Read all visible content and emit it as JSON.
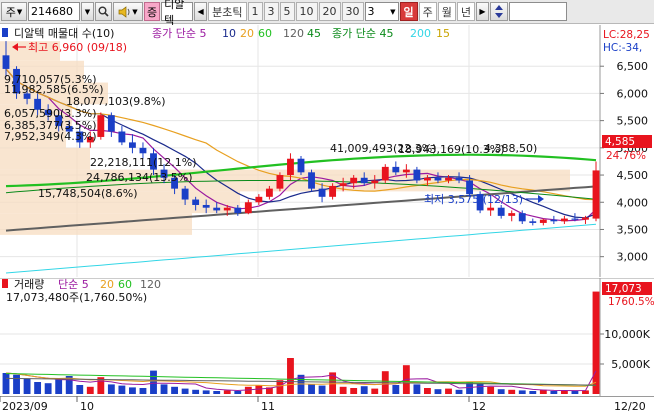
{
  "toolbar": {
    "mode_label": "주",
    "code": "214680",
    "search_icon": "magnifier-icon",
    "speaker_icon": "speaker-icon",
    "badge": "증",
    "stock_name": "디알텍",
    "period_prev_icon": "triangle-left-icon",
    "period_label": "분초틱",
    "intervals": [
      "1",
      "3",
      "5",
      "10",
      "20",
      "30"
    ],
    "interval_value": "3",
    "day_label": "일",
    "week_label": "주",
    "month_label": "월",
    "year_label": "년",
    "period_next_icon": "triangle-right-icon",
    "updown_icon": "up-down-arrows-icon"
  },
  "colors": {
    "up": "#e8141e",
    "down": "#1a3fc7",
    "ma5": "#9b1aa0",
    "ma10": "#1a2a8c",
    "ma20": "#e8a020",
    "ma60": "#22c022",
    "ma120": "#606060",
    "vma45": "#0b8a1a",
    "vma200": "#33d6e6",
    "vma15": "#c8a400",
    "box": "#f7dcc0"
  },
  "price_legend": {
    "title": "디알텍 매물대 수(10)",
    "ma_label": "종가 단순 5",
    "periods": [
      "10",
      "20",
      "60",
      "120",
      "45"
    ],
    "ma2_label": "종가 단순 45",
    "periods2": [
      "200",
      "15"
    ]
  },
  "price_axis": {
    "ticks": [
      "6,500",
      "6,000",
      "5,500",
      "5,000",
      "4,500",
      "4,000",
      "3,500",
      "3,000"
    ],
    "lc_label": "LC:28,25",
    "hc_label": "HC:-34,",
    "current_price": "4,585",
    "current_change": "24.76%"
  },
  "volume_profile": [
    "9,710,057(5.3%)",
    "11,982,585(6.5%)",
    "18,077,103(9.8%)",
    "6,057,590(3.3%)",
    "6,385,377(3.5%)",
    "7,952,349(4.3%)",
    "22,218,111(12.1%)",
    "24,786,134(13.5%)",
    "15,748,504(8.6%)",
    "41,009,493(22.3%)",
    "18,943,169(10.3%)",
    "4,388,50)"
  ],
  "annotations": {
    "high": "최고 6,960 (09/18)",
    "low": "최저 3,575 (12/13)"
  },
  "volume_legend": {
    "title": "거래량",
    "ma_label": "단순 5",
    "periods": [
      "20",
      "60",
      "120"
    ],
    "current": "17,073,480주(1,760.50%)"
  },
  "volume_axis": {
    "ticks": [
      "10,000K",
      "5,000K"
    ],
    "current": "17,073",
    "pct": "1760.5%"
  },
  "x_axis": {
    "labels": [
      "2023/09",
      "10",
      "11",
      "12",
      "12/20"
    ]
  },
  "chart_data": {
    "type": "candlestick",
    "ylim": [
      2700,
      7000
    ],
    "candles": [
      {
        "o": 6700,
        "h": 6960,
        "l": 6300,
        "c": 6450
      },
      {
        "o": 6450,
        "h": 6500,
        "l": 5900,
        "c": 6000
      },
      {
        "o": 6000,
        "h": 6100,
        "l": 5800,
        "c": 5900
      },
      {
        "o": 5900,
        "h": 6000,
        "l": 5600,
        "c": 5700
      },
      {
        "o": 5700,
        "h": 5800,
        "l": 5500,
        "c": 5600
      },
      {
        "o": 5600,
        "h": 5700,
        "l": 5300,
        "c": 5400
      },
      {
        "o": 5400,
        "h": 5500,
        "l": 5200,
        "c": 5300
      },
      {
        "o": 5300,
        "h": 5400,
        "l": 5000,
        "c": 5100
      },
      {
        "o": 5100,
        "h": 5300,
        "l": 5000,
        "c": 5200
      },
      {
        "o": 5200,
        "h": 5650,
        "l": 5150,
        "c": 5600
      },
      {
        "o": 5600,
        "h": 5650,
        "l": 5200,
        "c": 5300
      },
      {
        "o": 5300,
        "h": 5400,
        "l": 5050,
        "c": 5100
      },
      {
        "o": 5100,
        "h": 5250,
        "l": 4900,
        "c": 5000
      },
      {
        "o": 5000,
        "h": 5100,
        "l": 4800,
        "c": 4900
      },
      {
        "o": 4900,
        "h": 5000,
        "l": 4500,
        "c": 4600
      },
      {
        "o": 4600,
        "h": 4700,
        "l": 4350,
        "c": 4450
      },
      {
        "o": 4450,
        "h": 4500,
        "l": 4150,
        "c": 4250
      },
      {
        "o": 4250,
        "h": 4300,
        "l": 3950,
        "c": 4050
      },
      {
        "o": 4050,
        "h": 4100,
        "l": 3850,
        "c": 3950
      },
      {
        "o": 3950,
        "h": 4050,
        "l": 3800,
        "c": 3900
      },
      {
        "o": 3900,
        "h": 4000,
        "l": 3800,
        "c": 3850
      },
      {
        "o": 3850,
        "h": 3950,
        "l": 3750,
        "c": 3900
      },
      {
        "o": 3900,
        "h": 3950,
        "l": 3750,
        "c": 3800
      },
      {
        "o": 3800,
        "h": 4050,
        "l": 3780,
        "c": 4000
      },
      {
        "o": 4000,
        "h": 4150,
        "l": 3950,
        "c": 4100
      },
      {
        "o": 4100,
        "h": 4300,
        "l": 4050,
        "c": 4250
      },
      {
        "o": 4250,
        "h": 4550,
        "l": 4200,
        "c": 4500
      },
      {
        "o": 4500,
        "h": 4900,
        "l": 4400,
        "c": 4800
      },
      {
        "o": 4800,
        "h": 4850,
        "l": 4500,
        "c": 4550
      },
      {
        "o": 4550,
        "h": 4600,
        "l": 4200,
        "c": 4250
      },
      {
        "o": 4250,
        "h": 4350,
        "l": 4000,
        "c": 4100
      },
      {
        "o": 4100,
        "h": 4350,
        "l": 4050,
        "c": 4300
      },
      {
        "o": 4300,
        "h": 4450,
        "l": 4200,
        "c": 4350
      },
      {
        "o": 4350,
        "h": 4500,
        "l": 4250,
        "c": 4450
      },
      {
        "o": 4450,
        "h": 4550,
        "l": 4300,
        "c": 4350
      },
      {
        "o": 4350,
        "h": 4500,
        "l": 4250,
        "c": 4400
      },
      {
        "o": 4400,
        "h": 4700,
        "l": 4350,
        "c": 4650
      },
      {
        "o": 4650,
        "h": 4750,
        "l": 4500,
        "c": 4550
      },
      {
        "o": 4550,
        "h": 4700,
        "l": 4450,
        "c": 4600
      },
      {
        "o": 4600,
        "h": 4650,
        "l": 4350,
        "c": 4400
      },
      {
        "o": 4400,
        "h": 4500,
        "l": 4300,
        "c": 4450
      },
      {
        "o": 4450,
        "h": 4550,
        "l": 4350,
        "c": 4400
      },
      {
        "o": 4400,
        "h": 4500,
        "l": 4350,
        "c": 4450
      },
      {
        "o": 4450,
        "h": 4550,
        "l": 4350,
        "c": 4400
      },
      {
        "o": 4400,
        "h": 4500,
        "l": 4100,
        "c": 4150
      },
      {
        "o": 4150,
        "h": 4200,
        "l": 3800,
        "c": 3850
      },
      {
        "o": 3850,
        "h": 4000,
        "l": 3750,
        "c": 3900
      },
      {
        "o": 3900,
        "h": 3950,
        "l": 3700,
        "c": 3750
      },
      {
        "o": 3750,
        "h": 3850,
        "l": 3650,
        "c": 3800
      },
      {
        "o": 3800,
        "h": 3850,
        "l": 3600,
        "c": 3650
      },
      {
        "o": 3650,
        "h": 3700,
        "l": 3575,
        "c": 3620
      },
      {
        "o": 3620,
        "h": 3700,
        "l": 3575,
        "c": 3680
      },
      {
        "o": 3680,
        "h": 3750,
        "l": 3600,
        "c": 3650
      },
      {
        "o": 3650,
        "h": 3750,
        "l": 3600,
        "c": 3700
      },
      {
        "o": 3700,
        "h": 3800,
        "l": 3650,
        "c": 3680
      },
      {
        "o": 3680,
        "h": 3750,
        "l": 3600,
        "c": 3720
      },
      {
        "o": 3700,
        "h": 4750,
        "l": 3650,
        "c": 4585
      }
    ],
    "volumes": [
      3.5,
      3.2,
      2.6,
      2.0,
      1.8,
      2.4,
      3.0,
      1.5,
      1.2,
      2.8,
      1.6,
      1.4,
      1.1,
      1.0,
      3.9,
      1.6,
      1.2,
      0.9,
      0.7,
      0.6,
      0.5,
      0.6,
      0.5,
      1.2,
      1.4,
      1.1,
      2.3,
      6.0,
      3.2,
      1.6,
      1.4,
      3.6,
      1.2,
      1.0,
      1.3,
      0.9,
      3.8,
      1.5,
      4.8,
      1.6,
      1.0,
      0.8,
      0.9,
      0.7,
      2.0,
      1.8,
      1.2,
      0.8,
      0.7,
      0.6,
      0.5,
      0.7,
      0.5,
      0.6,
      0.5,
      0.6,
      17.07
    ],
    "vlim": [
      0,
      18
    ]
  }
}
